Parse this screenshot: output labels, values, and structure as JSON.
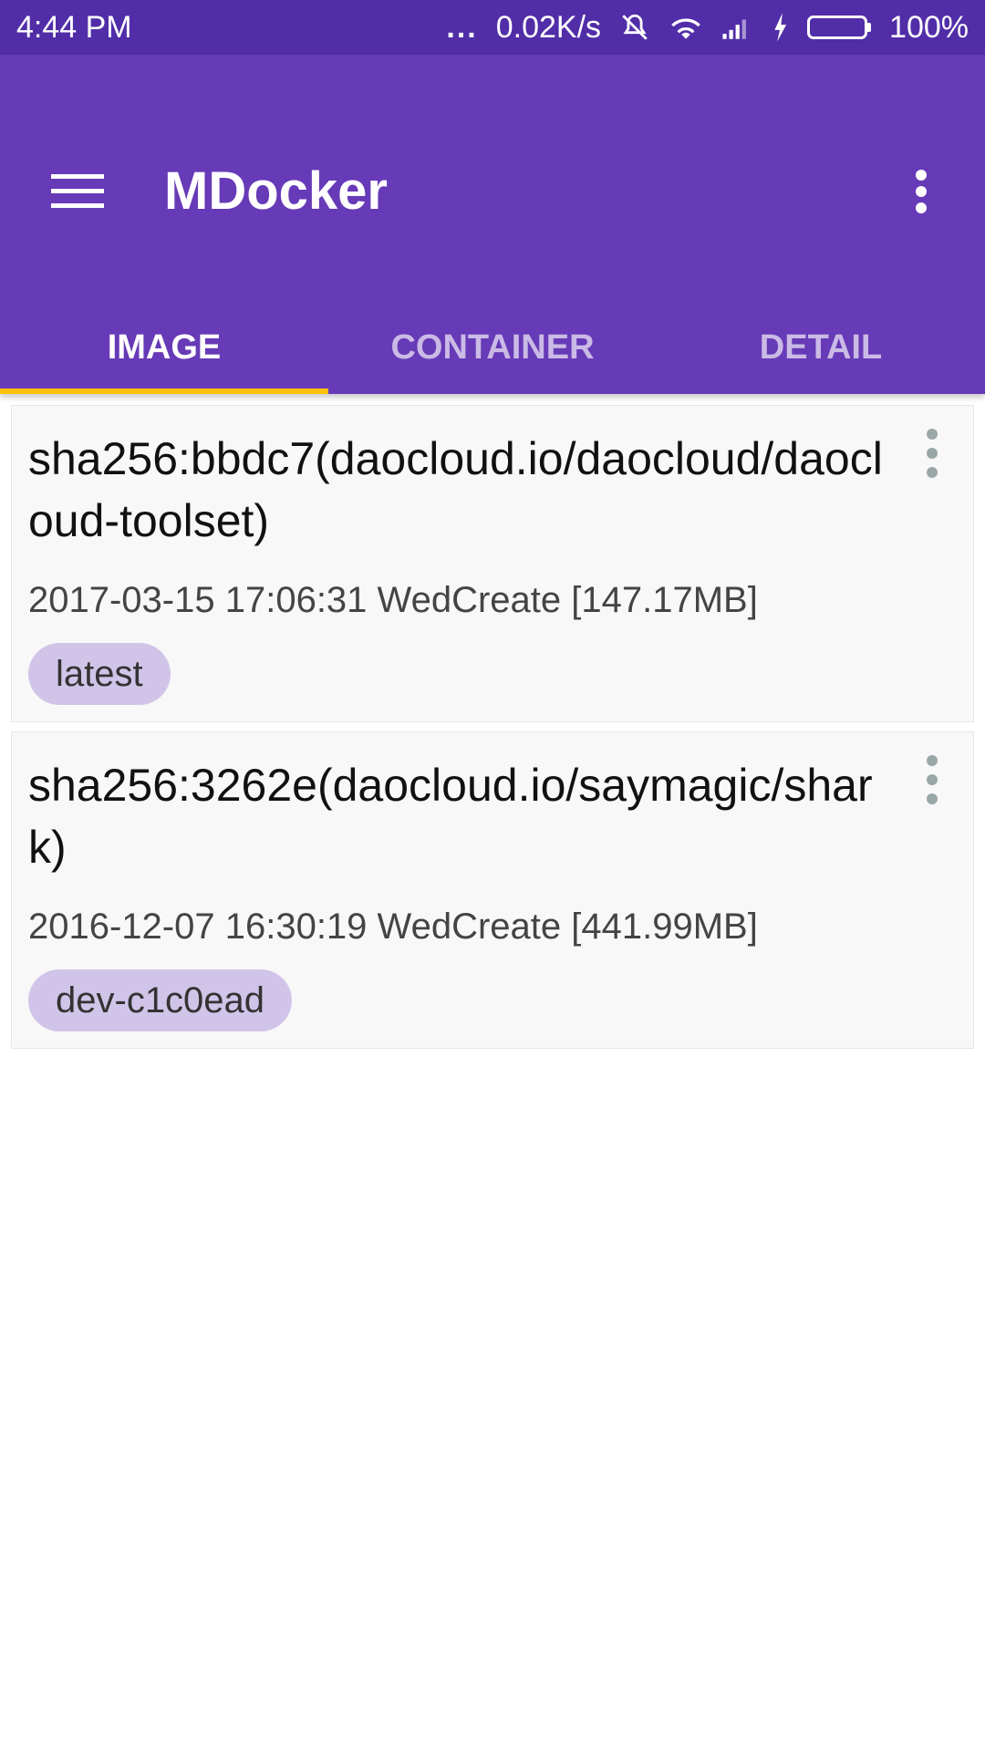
{
  "status_bar": {
    "time": "4:44 PM",
    "dots": "...",
    "network_speed": "0.02K/s",
    "battery_percent": "100%",
    "battery_level": 1.0,
    "icons": [
      "mute-icon",
      "wifi-icon",
      "signal-icon",
      "charging-icon",
      "battery-icon"
    ]
  },
  "app_bar": {
    "title": "MDocker",
    "menu_icon": "hamburger-menu-icon",
    "overflow_icon": "more-vert-icon",
    "background_color": "#673AB7",
    "status_color": "#512DA8",
    "indicator_color": "#FFC107"
  },
  "tabs": [
    {
      "label": "IMAGE",
      "active": true
    },
    {
      "label": "CONTAINER",
      "active": false
    },
    {
      "label": "DETAIL",
      "active": false
    }
  ],
  "images": [
    {
      "title": "sha256:bbdc7(daocloud.io/daocloud/daocloud-toolset)",
      "meta": "2017-03-15 17:06:31 WedCreate [147.17MB]",
      "tag": "latest"
    },
    {
      "title": "sha256:3262e(daocloud.io/saymagic/shark)",
      "meta": "2016-12-07 16:30:19 WedCreate [441.99MB]",
      "tag": "dev-c1c0ead"
    }
  ]
}
